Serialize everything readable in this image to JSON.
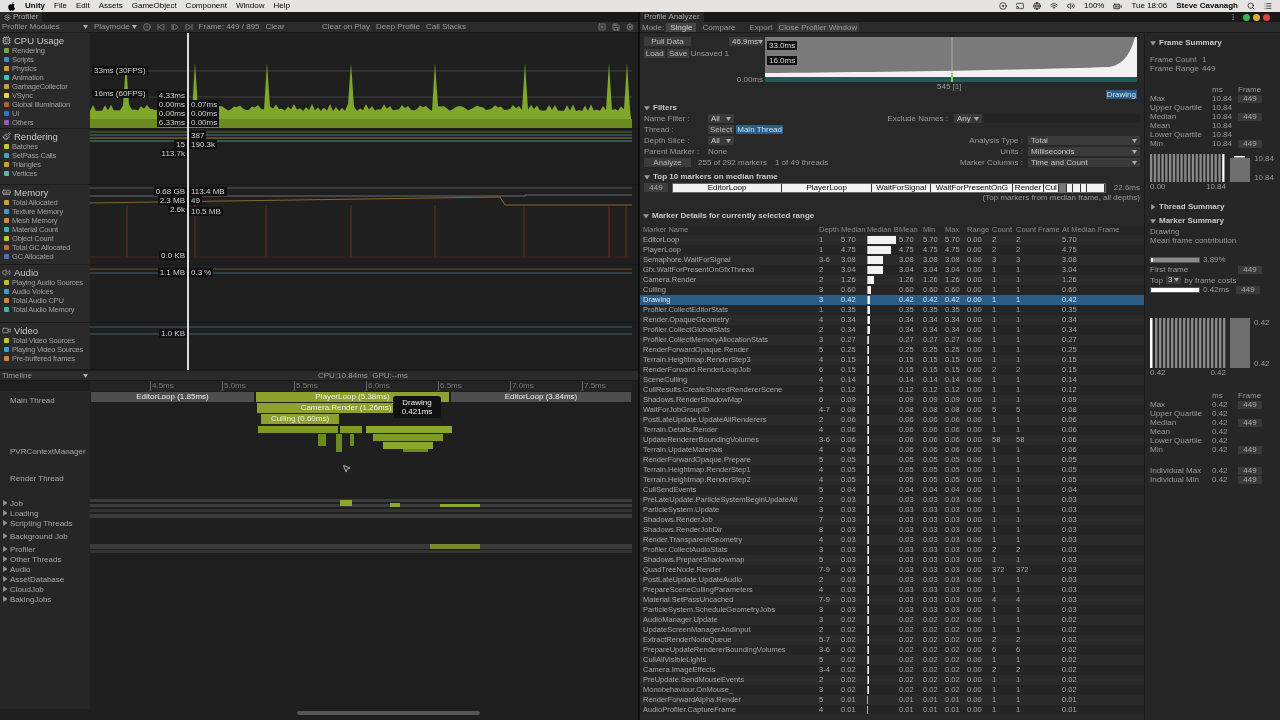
{
  "menu_bar": {
    "app": "Unity",
    "menus": [
      "File",
      "Edit",
      "Assets",
      "GameObject",
      "Component",
      "Window",
      "Help"
    ],
    "battery": "100%",
    "clock": "Tue 18:06",
    "user": "Steve Cavanagh"
  },
  "profiler": {
    "tab": "Profiler",
    "modules_dropdown": "Profiler Modules",
    "target": "Playmode",
    "frame": "Frame: 449 / 895",
    "clear": "Clear",
    "options": [
      "Clear on Play",
      "Deep Profile",
      "Call Stacks"
    ],
    "modules": [
      {
        "kind": "cpu",
        "title": "CPU Usage",
        "items": [
          {
            "name": "Rendering",
            "color": "#7aa63a"
          },
          {
            "name": "Scripts",
            "color": "#3d8fd1"
          },
          {
            "name": "Physics",
            "color": "#e0933a"
          },
          {
            "name": "Animation",
            "color": "#3ec2c2"
          },
          {
            "name": "GarbageCollector",
            "color": "#c1a23c"
          },
          {
            "name": "VSync",
            "color": "#e9d94a"
          },
          {
            "name": "Global Illumination",
            "color": "#b85c33"
          },
          {
            "name": "UI",
            "color": "#3c6fc9"
          },
          {
            "name": "Others",
            "color": "#8e5bbd"
          }
        ],
        "readouts": [
          "33ms (30FPS)",
          "16ms (60FPS)",
          "4.33ms",
          "0.00ms",
          "0.00ms",
          "6.33ms",
          "0.07ms",
          "0.00ms",
          "0.00ms"
        ]
      },
      {
        "kind": "rendering",
        "title": "Rendering",
        "items": [
          {
            "name": "Batches",
            "color": "#c8c235"
          },
          {
            "name": "SetPass Calls",
            "color": "#3aa7c7"
          },
          {
            "name": "Triangles",
            "color": "#d59b3a"
          },
          {
            "name": "Vertices",
            "color": "#58b6b0"
          }
        ],
        "readouts": [
          "387",
          "15",
          "190.3k",
          "113.7k"
        ]
      },
      {
        "kind": "memory",
        "title": "Memory",
        "items": [
          {
            "name": "Total Allocated",
            "color": "#c7a53a"
          },
          {
            "name": "Texture Memory",
            "color": "#3d9bd0"
          },
          {
            "name": "Mesh Memory",
            "color": "#d48a3a"
          },
          {
            "name": "Material Count",
            "color": "#38b7b0"
          },
          {
            "name": "Object Count",
            "color": "#c8c23a"
          },
          {
            "name": "Total GC Allocated",
            "color": "#c56e2f"
          },
          {
            "name": "GC Allocated",
            "color": "#4b6fc2"
          }
        ],
        "readouts": [
          "0.68 GB",
          "113.4 MB",
          "2.3 MB",
          "49",
          "2.6k",
          "10.5 MB",
          "0.0 KB"
        ]
      },
      {
        "kind": "audio",
        "title": "Audio",
        "items": [
          {
            "name": "Playing Audio Sources",
            "color": "#c2b93a"
          },
          {
            "name": "Audio Voices",
            "color": "#3a9fd0"
          },
          {
            "name": "Total Audio CPU",
            "color": "#d2873a"
          },
          {
            "name": "Total Audio Memory",
            "color": "#3ab5b0"
          }
        ],
        "readouts": [
          "1.1 MB",
          "0.3 %"
        ]
      },
      {
        "kind": "video",
        "title": "Video",
        "items": [
          {
            "name": "Total Video Sources",
            "color": "#c8c23a"
          },
          {
            "name": "Playing Video Sources",
            "color": "#3a9fd0"
          },
          {
            "name": "Pre-buffered frames",
            "color": "#d2873a"
          }
        ],
        "readouts": [
          "1.0 KB"
        ]
      }
    ]
  },
  "timeline": {
    "view": "Timeline",
    "summary": "CPU:10.84ms  GPU:--ms",
    "ticks": [
      "4.5ms",
      "5.0ms",
      "5.5ms",
      "6.0ms",
      "6.5ms",
      "7.0ms",
      "7.5ms"
    ],
    "threads": [
      {
        "kind": "thread",
        "name": "Main Thread"
      },
      {
        "kind": "thread",
        "name": "PVRContextManager"
      },
      {
        "kind": "thread",
        "name": "Render Thread"
      },
      {
        "kind": "group",
        "name": "Job",
        "expanded": false
      },
      {
        "kind": "group",
        "name": "Loading",
        "expanded": false
      },
      {
        "kind": "group",
        "name": "Scripting Threads",
        "expanded": false
      },
      {
        "kind": "group",
        "name": "Background Job",
        "expanded": false
      },
      {
        "kind": "group",
        "name": "Profiler",
        "expanded": false
      },
      {
        "kind": "group",
        "name": "Other Threads",
        "expanded": false
      },
      {
        "kind": "group",
        "name": "Audio",
        "expanded": false
      },
      {
        "kind": "group",
        "name": "AssetDatabase",
        "expanded": false
      },
      {
        "kind": "group",
        "name": "CloudJob",
        "expanded": false
      },
      {
        "kind": "group",
        "name": "BakingJobs",
        "expanded": false
      }
    ],
    "markers": [
      {
        "kind": "editor",
        "label": "EditorLoop (1.85ms)"
      },
      {
        "kind": "player",
        "label": "PlayerLoop (5.38ms)"
      },
      {
        "kind": "player",
        "label": "Camera.Render (1.26ms)"
      },
      {
        "kind": "player",
        "label": "Culling (0.60ms)"
      },
      {
        "kind": "editor",
        "label": "EditorLoop (3.84ms)"
      }
    ],
    "tooltip": {
      "title": "Drawing",
      "value": "0.421ms"
    }
  },
  "analyzer": {
    "tab": "Profile Analyzer",
    "mode_label": "Mode:",
    "modes": [
      {
        "label": "Single",
        "selected": true
      },
      {
        "label": "Compare",
        "selected": false
      }
    ],
    "export": "Export",
    "close": "Close Profiler Window",
    "pull": "Pull Data",
    "load": "Load",
    "save": "Save",
    "file": "Unsaved 1",
    "range": "46.9ms",
    "graph_labels": [
      "33.0ms",
      "16.0ms"
    ],
    "graph_min": "0.00ms",
    "graph_frame": "545 [1]",
    "selection_tag": "Drawing",
    "filters": {
      "title": "Filters",
      "expanded": true,
      "name_label": "Name Filter :",
      "name_value": "All",
      "exclude_label": "Exclude Names :",
      "exclude_value": "Any",
      "thread_label": "Thread :",
      "thread_button": "Select",
      "thread_value": "Main Thread",
      "depth_label": "Depth Slice :",
      "depth_value": "All",
      "parent_label": "Parent Marker :",
      "parent_value": "None",
      "analysis_label": "Analysis Type :",
      "analysis_value": "Total",
      "units_label": "Units :",
      "units_value": "Milliseconds",
      "columns_label": "Marker Columns :",
      "columns_value": "Time and Count",
      "analyze": "Analyze",
      "markers": "255 of 292 markers",
      "threads": "1 of 49 threads"
    },
    "top10": {
      "title": "Top 10 markers on median frame",
      "expanded": true,
      "frame": "449",
      "total": "22.6ms",
      "note": "(Top markers from median frame, all depths)",
      "segments": [
        {
          "label": "EditorLoop",
          "selected": false
        },
        {
          "label": "PlayerLoop",
          "selected": false
        },
        {
          "label": "WaitForSignal",
          "selected": false
        },
        {
          "label": "WaitForPresentOnG",
          "selected": false
        },
        {
          "label": "Render",
          "selected": false
        },
        {
          "label": "Cul",
          "selected": false
        },
        {
          "selected": true
        },
        {
          "selected": false
        },
        {
          "selected": false
        },
        {
          "selected": false
        },
        {
          "selected": false
        }
      ]
    },
    "details": {
      "title": "Marker Details for currently selected range",
      "expanded": true,
      "columns": [
        "Marker Name",
        "Depth",
        "Median",
        "Median B",
        "Mean",
        "Min",
        "Max",
        "Range",
        "Count",
        "Count Frame",
        "At Median Frame"
      ],
      "rows": [
        {
          "cells": [
            "EditorLoop",
            "1",
            "5.70",
            "",
            "5.70",
            "5.70",
            "5.70",
            "0.00",
            "2",
            "2",
            "5.70"
          ],
          "level": 1,
          "selected": false
        },
        {
          "cells": [
            "PlayerLoop",
            "1",
            "4.75",
            "",
            "4.75",
            "4.75",
            "4.75",
            "0.00",
            "2",
            "2",
            "4.75"
          ],
          "level": 0.833,
          "selected": false
        },
        {
          "cells": [
            "Semaphore.WaitForSignal",
            "3-6",
            "3.08",
            "",
            "3.08",
            "3.08",
            "3.08",
            "0.00",
            "3",
            "3",
            "3.08"
          ],
          "level": 0.54,
          "selected": false
        },
        {
          "cells": [
            "Gfx.WaitForPresentOnGfxThread",
            "2",
            "3.04",
            "",
            "3.04",
            "3.04",
            "3.04",
            "0.00",
            "1",
            "1",
            "3.04"
          ],
          "level": 0.533,
          "selected": false
        },
        {
          "cells": [
            "Camera.Render",
            "2",
            "1.26",
            "",
            "1.26",
            "1.26",
            "1.26",
            "0.00",
            "1",
            "1",
            "1.26"
          ],
          "level": 0.221,
          "selected": false
        },
        {
          "cells": [
            "Culling",
            "3",
            "0.60",
            "",
            "0.60",
            "0.60",
            "0.60",
            "0.00",
            "1",
            "1",
            "0.60"
          ],
          "level": 0.105,
          "selected": false
        },
        {
          "cells": [
            "Drawing",
            "3",
            "0.42",
            "",
            "0.42",
            "0.42",
            "0.42",
            "0.00",
            "1",
            "1",
            "0.42"
          ],
          "level": 0.074,
          "selected": true
        },
        {
          "cells": [
            "Profiler.CollectEditorStats",
            "1",
            "0.35",
            "",
            "0.35",
            "0.35",
            "0.35",
            "0.00",
            "1",
            "1",
            "0.35"
          ],
          "level": 0.061,
          "selected": false
        },
        {
          "cells": [
            "Render.OpaqueGeometry",
            "4",
            "0.34",
            "",
            "0.34",
            "0.34",
            "0.34",
            "0.00",
            "1",
            "1",
            "0.34"
          ],
          "level": 0.06,
          "selected": false
        },
        {
          "cells": [
            "Profiler.CollectGlobalStats",
            "2",
            "0.34",
            "",
            "0.34",
            "0.34",
            "0.34",
            "0.00",
            "1",
            "1",
            "0.34"
          ],
          "level": 0.06,
          "selected": false
        },
        {
          "cells": [
            "Profiler.CollectMemoryAllocationStats",
            "3",
            "0.27",
            "",
            "0.27",
            "0.27",
            "0.27",
            "0.00",
            "1",
            "1",
            "0.27"
          ],
          "level": 0.047,
          "selected": false
        },
        {
          "cells": [
            "RenderForwardOpaque.Render",
            "5",
            "0.25",
            "",
            "0.25",
            "0.25",
            "0.25",
            "0.00",
            "1",
            "1",
            "0.25"
          ],
          "level": 0.044,
          "selected": false
        },
        {
          "cells": [
            "Terrain.Heightmap.RenderStep3",
            "4",
            "0.15",
            "",
            "0.15",
            "0.15",
            "0.15",
            "0.00",
            "1",
            "1",
            "0.15"
          ],
          "level": 0.026,
          "selected": false
        },
        {
          "cells": [
            "RenderForward.RenderLoopJob",
            "6",
            "0.15",
            "",
            "0.15",
            "0.15",
            "0.15",
            "0.00",
            "2",
            "2",
            "0.15"
          ],
          "level": 0.026,
          "selected": false
        },
        {
          "cells": [
            "SceneCulling",
            "4",
            "0.14",
            "",
            "0.14",
            "0.14",
            "0.14",
            "0.00",
            "1",
            "1",
            "0.14"
          ],
          "level": 0.025,
          "selected": false
        },
        {
          "cells": [
            "CullResults.CreateSharedRendererScene",
            "3",
            "0.12",
            "",
            "0.12",
            "0.12",
            "0.12",
            "0.00",
            "1",
            "1",
            "0.12"
          ],
          "level": 0.021,
          "selected": false
        },
        {
          "cells": [
            "Shadows.RenderShadowMap",
            "6",
            "0.09",
            "",
            "0.09",
            "0.09",
            "0.09",
            "0.00",
            "1",
            "1",
            "0.09"
          ],
          "level": 0.016,
          "selected": false
        },
        {
          "cells": [
            "WaitForJobGroupID",
            "4-7",
            "0.08",
            "",
            "0.08",
            "0.08",
            "0.08",
            "0.00",
            "5",
            "5",
            "0.08"
          ],
          "level": 0.014,
          "selected": false
        },
        {
          "cells": [
            "PostLateUpdate.UpdateAllRenderers",
            "2",
            "0.06",
            "",
            "0.06",
            "0.06",
            "0.06",
            "0.00",
            "1",
            "1",
            "0.06"
          ],
          "level": 0.011,
          "selected": false
        },
        {
          "cells": [
            "Terrain.Details.Render",
            "4",
            "0.06",
            "",
            "0.06",
            "0.06",
            "0.06",
            "0.00",
            "1",
            "1",
            "0.06"
          ],
          "level": 0.011,
          "selected": false
        },
        {
          "cells": [
            "UpdateRendererBoundingVolumes",
            "3-6",
            "0.06",
            "",
            "0.06",
            "0.06",
            "0.06",
            "0.00",
            "58",
            "58",
            "0.06"
          ],
          "level": 0.011,
          "selected": false
        },
        {
          "cells": [
            "Terrain.UpdateMaterials",
            "4",
            "0.06",
            "",
            "0.06",
            "0.06",
            "0.06",
            "0.00",
            "1",
            "1",
            "0.06"
          ],
          "level": 0.011,
          "selected": false
        },
        {
          "cells": [
            "RenderForwardOpaque.Prepare",
            "5",
            "0.05",
            "",
            "0.05",
            "0.05",
            "0.05",
            "0.00",
            "1",
            "1",
            "0.05"
          ],
          "level": 0.009,
          "selected": false
        },
        {
          "cells": [
            "Terrain.Heightmap.RenderStep1",
            "4",
            "0.05",
            "",
            "0.05",
            "0.05",
            "0.05",
            "0.00",
            "1",
            "1",
            "0.05"
          ],
          "level": 0.009,
          "selected": false
        },
        {
          "cells": [
            "Terrain.Heightmap.RenderStep2",
            "4",
            "0.05",
            "",
            "0.05",
            "0.05",
            "0.05",
            "0.00",
            "1",
            "1",
            "0.05"
          ],
          "level": 0.009,
          "selected": false
        },
        {
          "cells": [
            "CullSendEvents",
            "5",
            "0.04",
            "",
            "0.04",
            "0.04",
            "0.04",
            "0.00",
            "1",
            "1",
            "0.04"
          ],
          "level": 0.007,
          "selected": false
        },
        {
          "cells": [
            "PreLateUpdate.ParticleSystemBeginUpdateAll",
            "2",
            "0.03",
            "",
            "0.03",
            "0.03",
            "0.03",
            "0.00",
            "1",
            "1",
            "0.03"
          ],
          "level": 0.005,
          "selected": false
        },
        {
          "cells": [
            "ParticleSystem.Update",
            "3",
            "0.03",
            "",
            "0.03",
            "0.03",
            "0.03",
            "0.00",
            "1",
            "1",
            "0.03"
          ],
          "level": 0.005,
          "selected": false
        },
        {
          "cells": [
            "Shadows.RenderJob",
            "7",
            "0.03",
            "",
            "0.03",
            "0.03",
            "0.03",
            "0.00",
            "1",
            "1",
            "0.03"
          ],
          "level": 0.005,
          "selected": false
        },
        {
          "cells": [
            "Shadows.RenderJobDir",
            "8",
            "0.03",
            "",
            "0.03",
            "0.03",
            "0.03",
            "0.00",
            "1",
            "1",
            "0.03"
          ],
          "level": 0.005,
          "selected": false
        },
        {
          "cells": [
            "Render.TransparentGeometry",
            "4",
            "0.03",
            "",
            "0.03",
            "0.03",
            "0.03",
            "0.00",
            "1",
            "1",
            "0.03"
          ],
          "level": 0.005,
          "selected": false
        },
        {
          "cells": [
            "Profiler.CollectAudioStats",
            "3",
            "0.03",
            "",
            "0.03",
            "0.03",
            "0.03",
            "0.00",
            "2",
            "2",
            "0.03"
          ],
          "level": 0.005,
          "selected": false
        },
        {
          "cells": [
            "Shadows.PrepareShadowmap",
            "5",
            "0.03",
            "",
            "0.03",
            "0.03",
            "0.03",
            "0.00",
            "1",
            "1",
            "0.03"
          ],
          "level": 0.005,
          "selected": false
        },
        {
          "cells": [
            "QuadTreeNode.Render",
            "7-9",
            "0.03",
            "",
            "0.03",
            "0.03",
            "0.03",
            "0.00",
            "372",
            "372",
            "0.03"
          ],
          "level": 0.005,
          "selected": false
        },
        {
          "cells": [
            "PostLateUpdate.UpdateAudio",
            "2",
            "0.03",
            "",
            "0.03",
            "0.03",
            "0.03",
            "0.00",
            "1",
            "1",
            "0.03"
          ],
          "level": 0.005,
          "selected": false
        },
        {
          "cells": [
            "PrepareSceneCullingParameters",
            "4",
            "0.03",
            "",
            "0.03",
            "0.03",
            "0.03",
            "0.00",
            "1",
            "1",
            "0.03"
          ],
          "level": 0.005,
          "selected": false
        },
        {
          "cells": [
            "Material.SetPassUncached",
            "7-9",
            "0.03",
            "",
            "0.03",
            "0.03",
            "0.03",
            "0.00",
            "4",
            "4",
            "0.03"
          ],
          "level": 0.005,
          "selected": false
        },
        {
          "cells": [
            "ParticleSystem.ScheduleGeometryJobs",
            "3",
            "0.03",
            "",
            "0.03",
            "0.03",
            "0.03",
            "0.00",
            "1",
            "1",
            "0.03"
          ],
          "level": 0.005,
          "selected": false
        },
        {
          "cells": [
            "AudioManager.Update",
            "3",
            "0.02",
            "",
            "0.02",
            "0.02",
            "0.02",
            "0.00",
            "1",
            "1",
            "0.02"
          ],
          "level": 0.004,
          "selected": false
        },
        {
          "cells": [
            "UpdateScreenManagerAndInput",
            "2",
            "0.02",
            "",
            "0.02",
            "0.02",
            "0.02",
            "0.00",
            "1",
            "1",
            "0.02"
          ],
          "level": 0.004,
          "selected": false
        },
        {
          "cells": [
            "ExtractRenderNodeQueue",
            "5-7",
            "0.02",
            "",
            "0.02",
            "0.02",
            "0.02",
            "0.00",
            "2",
            "2",
            "0.02"
          ],
          "level": 0.004,
          "selected": false
        },
        {
          "cells": [
            "PrepareUpdateRendererBoundingVolumes",
            "3-6",
            "0.02",
            "",
            "0.02",
            "0.02",
            "0.02",
            "0.00",
            "6",
            "6",
            "0.02"
          ],
          "level": 0.004,
          "selected": false
        },
        {
          "cells": [
            "CullAllVisibleLights",
            "5",
            "0.02",
            "",
            "0.02",
            "0.02",
            "0.02",
            "0.00",
            "1",
            "1",
            "0.02"
          ],
          "level": 0.004,
          "selected": false
        },
        {
          "cells": [
            "Camera.ImageEffects",
            "3-4",
            "0.02",
            "",
            "0.02",
            "0.02",
            "0.02",
            "0.00",
            "2",
            "2",
            "0.02"
          ],
          "level": 0.004,
          "selected": false
        },
        {
          "cells": [
            "PreUpdate.SendMouseEvents",
            "2",
            "0.02",
            "",
            "0.02",
            "0.02",
            "0.02",
            "0.00",
            "1",
            "1",
            "0.02"
          ],
          "level": 0.004,
          "selected": false
        },
        {
          "cells": [
            "Monobehaviour.OnMouse_",
            "3",
            "0.02",
            "",
            "0.02",
            "0.02",
            "0.02",
            "0.00",
            "1",
            "1",
            "0.02"
          ],
          "level": 0.004,
          "selected": false
        },
        {
          "cells": [
            "RenderForwardAlpha.Render",
            "5",
            "0.01",
            "",
            "0.01",
            "0.01",
            "0.01",
            "0.00",
            "1",
            "1",
            "0.01"
          ],
          "level": 0.002,
          "selected": false
        },
        {
          "cells": [
            "AudioProfiler.CaptureFrame",
            "4",
            "0.01",
            "",
            "0.01",
            "0.01",
            "0.01",
            "0.00",
            "1",
            "1",
            "0.01"
          ],
          "level": 0.002,
          "selected": false
        }
      ]
    }
  },
  "frame_summary": {
    "title": "Frame Summary",
    "expanded": true,
    "info": [
      {
        "label": "Frame Count",
        "value": "1"
      },
      {
        "label": "Frame Range",
        "value": "449"
      }
    ],
    "headers": [
      "ms",
      "Frame"
    ],
    "stats": [
      {
        "label": "Max",
        "value": "10.84",
        "frame": "449"
      },
      {
        "label": "Upper Quartile",
        "value": "10.84"
      },
      {
        "label": "Median",
        "value": "10.84",
        "frame": "449"
      },
      {
        "label": "Mean",
        "value": "10.84"
      },
      {
        "label": "Lower Quartile",
        "value": "10.84"
      },
      {
        "label": "Min",
        "value": "10.84",
        "frame": "449"
      }
    ],
    "histogram_labels": [
      "0.00",
      "10.84"
    ],
    "box_labels": [
      "10.84",
      "10.84"
    ]
  },
  "thread_summary": {
    "title": "Thread Summary",
    "expanded": false
  },
  "marker_summary": {
    "title": "Marker Summary",
    "expanded": true,
    "marker": "Drawing",
    "caption": "Mean frame contribution",
    "contribution": {
      "level": 0.04,
      "label": "3.89%"
    },
    "first_frame_label": "First frame",
    "first_frame": "449",
    "top_label": "Top",
    "top_count": "3",
    "top_suffix": "by frame costs",
    "top_bars": [
      {
        "level": 1,
        "label": "0.42ms",
        "frame": "449"
      }
    ],
    "histogram_labels": [
      "0.42",
      "0.42"
    ],
    "box_labels": [
      "0.42",
      "0.42"
    ],
    "headers": [
      "ms",
      "Frame"
    ],
    "stats": [
      {
        "label": "Max",
        "value": "0.42",
        "frame": "449"
      },
      {
        "label": "Upper Quartile",
        "value": "0.42"
      },
      {
        "label": "Median",
        "value": "0.42",
        "frame": "449"
      },
      {
        "label": "Mean",
        "value": "0.42"
      },
      {
        "label": "Lower Quartile",
        "value": "0.42"
      },
      {
        "label": "Min",
        "value": "0.42",
        "frame": "449"
      }
    ],
    "individual": [
      {
        "label": "Individual Max",
        "value": "0.42",
        "frame": "449"
      },
      {
        "label": "Individual Min",
        "value": "0.42",
        "frame": "449"
      }
    ]
  }
}
